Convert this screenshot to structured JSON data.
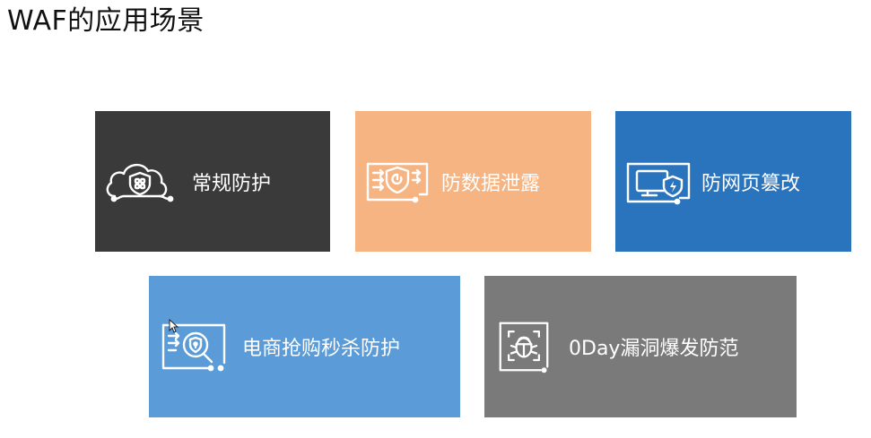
{
  "title": "WAF的应用场景",
  "cards": [
    {
      "label": "常规防护",
      "icon": "cloud-shield-icon",
      "color": "#3a3a3a"
    },
    {
      "label": "防数据泄露",
      "icon": "data-leak-shield-icon",
      "color": "#f6b483"
    },
    {
      "label": "防网页篡改",
      "icon": "monitor-shield-icon",
      "color": "#2a74be"
    },
    {
      "label": "电商抢购秒杀防护",
      "icon": "magnify-shield-icon",
      "color": "#5a9bd8"
    },
    {
      "label": "0Day漏洞爆发防范",
      "icon": "bug-scan-icon",
      "color": "#7a7a7a"
    }
  ]
}
